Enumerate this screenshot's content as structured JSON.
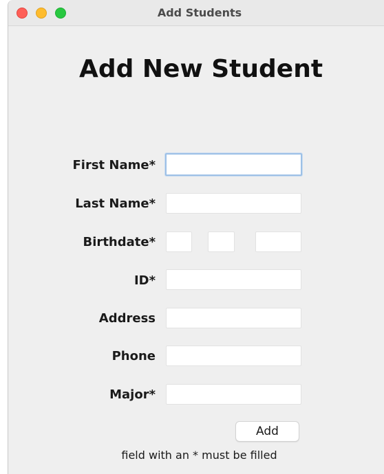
{
  "window": {
    "title": "Add Students"
  },
  "form": {
    "heading": "Add New Student",
    "fields": {
      "first_name": {
        "label": "First Name*",
        "value": ""
      },
      "last_name": {
        "label": "Last Name*",
        "value": ""
      },
      "birthdate": {
        "label": "Birthdate*",
        "day": "",
        "month": "",
        "year": ""
      },
      "id": {
        "label": "ID*",
        "value": ""
      },
      "address": {
        "label": "Address",
        "value": ""
      },
      "phone": {
        "label": "Phone",
        "value": ""
      },
      "major": {
        "label": "Major*",
        "value": ""
      }
    },
    "add_button": "Add",
    "footnote": "field with an * must be filled"
  },
  "colors": {
    "window_background": "#efefef",
    "focus_ring": "#9dc0e6",
    "traffic_close": "#fe5f57",
    "traffic_minimize": "#febc2e",
    "traffic_maximize": "#28c840"
  }
}
